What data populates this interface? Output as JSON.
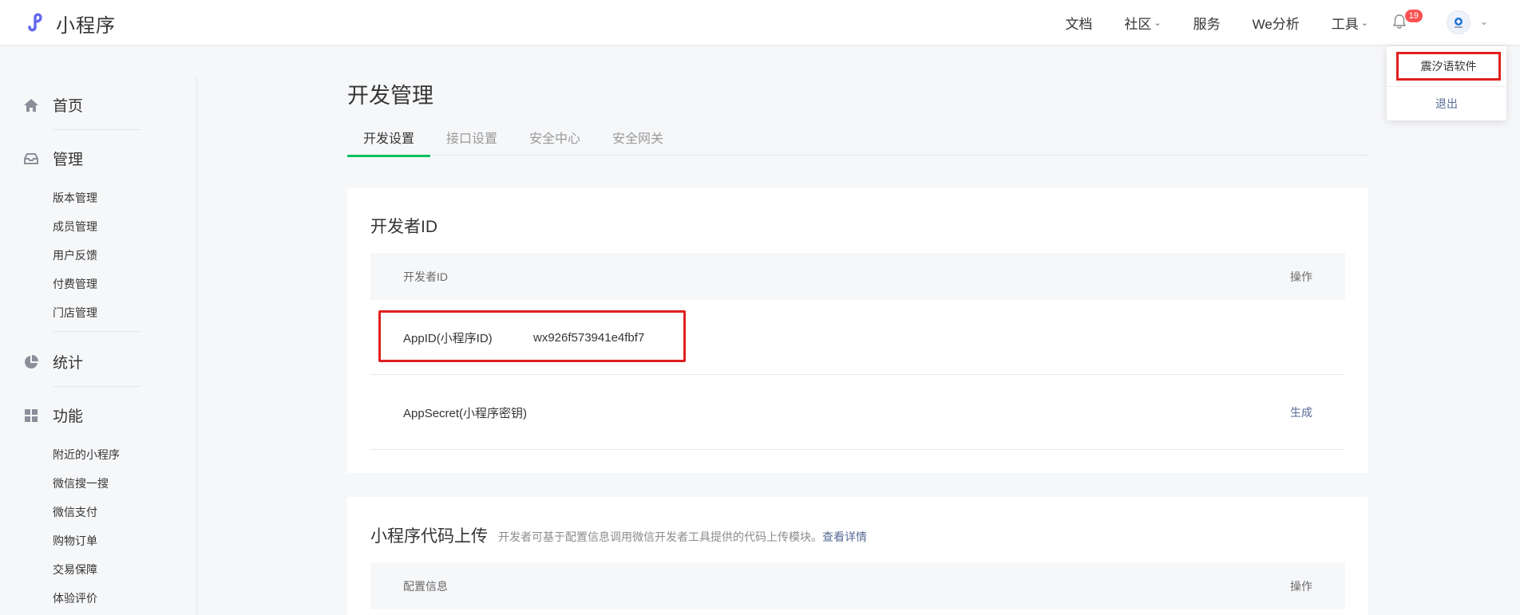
{
  "brand": {
    "name": "小程序",
    "logo_icon": "miniprogram-logo-icon",
    "accent": "#6467f0"
  },
  "header": {
    "nav": [
      {
        "label": "文档",
        "has_dropdown": false
      },
      {
        "label": "社区",
        "has_dropdown": true
      },
      {
        "label": "服务",
        "has_dropdown": false
      },
      {
        "label": "We分析",
        "has_dropdown": false
      },
      {
        "label": "工具",
        "has_dropdown": true
      }
    ],
    "notification_count": "19",
    "avatar_icon": "account-avatar-icon"
  },
  "account_menu": {
    "account_name": "震汐语软件",
    "logout_label": "退出"
  },
  "sidebar": {
    "groups": [
      {
        "label": "首页",
        "icon": "home-icon",
        "items": []
      },
      {
        "label": "管理",
        "icon": "inbox-icon",
        "items": [
          "版本管理",
          "成员管理",
          "用户反馈",
          "付费管理",
          "门店管理"
        ]
      },
      {
        "label": "统计",
        "icon": "pie-chart-icon",
        "items": []
      },
      {
        "label": "功能",
        "icon": "grid-icon",
        "items": [
          "附近的小程序",
          "微信搜一搜",
          "微信支付",
          "购物订单",
          "交易保障",
          "体验评价"
        ]
      }
    ]
  },
  "main": {
    "title": "开发管理",
    "tabs": [
      {
        "label": "开发设置",
        "active": true
      },
      {
        "label": "接口设置",
        "active": false
      },
      {
        "label": "安全中心",
        "active": false
      },
      {
        "label": "安全网关",
        "active": false
      }
    ],
    "developer_id_card": {
      "title": "开发者ID",
      "headers": {
        "name": "开发者ID",
        "action": "操作"
      },
      "rows": [
        {
          "name": "AppID(小程序ID)",
          "value": "wx926f573941e4fbf7",
          "action": ""
        },
        {
          "name": "AppSecret(小程序密钥)",
          "value": "",
          "action": "生成"
        }
      ]
    },
    "upload_card": {
      "title": "小程序代码上传",
      "description": "开发者可基于配置信息调用微信开发者工具提供的代码上传模块。",
      "details_link": "查看详情",
      "headers": {
        "name": "配置信息",
        "action": "操作"
      }
    }
  },
  "colors": {
    "highlight": "#e02020",
    "link": "#576b95",
    "tab_active": "#07c160",
    "badge": "#fa5151"
  }
}
